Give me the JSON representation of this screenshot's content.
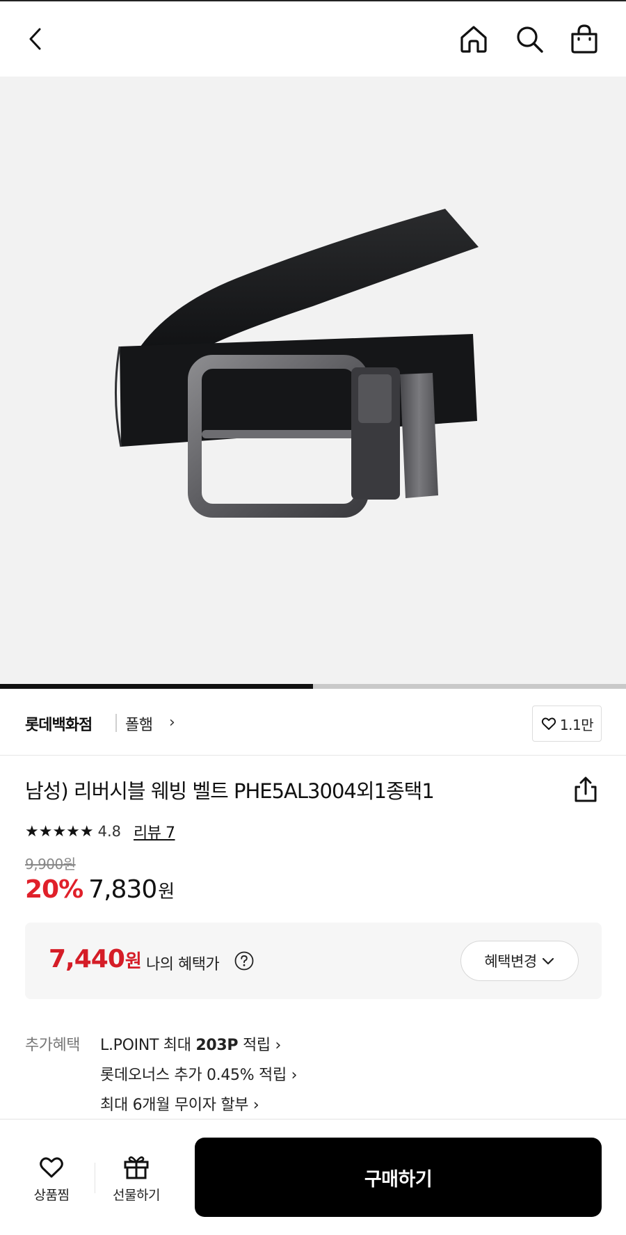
{
  "header": {
    "back_icon": "chevron-left-icon",
    "home_icon": "home-icon",
    "search_icon": "search-icon",
    "bag_icon": "shopping-bag-icon"
  },
  "gallery": {
    "image_subject": "belt-product-image",
    "progress": 0.5
  },
  "brand": {
    "store": "롯데백화점",
    "name": "폴햄",
    "arrow": "›",
    "like_count": "1.1만"
  },
  "product": {
    "title": "남성) 리버시블 웨빙 벨트 PHE5AL3004외1종택1",
    "stars": "★★★★★",
    "rating": "4.8",
    "review_label": "리뷰 7",
    "original_price": "9,900원",
    "discount": "20%",
    "sale_price": "7,830",
    "sale_won": "원"
  },
  "benefit": {
    "price": "7,440",
    "won": "원",
    "label": "나의 혜택가",
    "change_label": "혜택변경"
  },
  "extra": {
    "label": "추가혜택",
    "line1_prefix": "L.POINT 최대 ",
    "line1_bold": "203P",
    "line1_suffix": " 적립 ›",
    "line2": "롯데오너스 추가 0.45% 적립 ›",
    "line3": "최대 6개월 무이자 할부 ›"
  },
  "bottom": {
    "wish_label": "상품찜",
    "gift_label": "선물하기",
    "buy_label": "구매하기"
  },
  "colors": {
    "accent_red": "#e0202a",
    "benefit_red": "#d51d27",
    "buy_button": "#000000"
  }
}
